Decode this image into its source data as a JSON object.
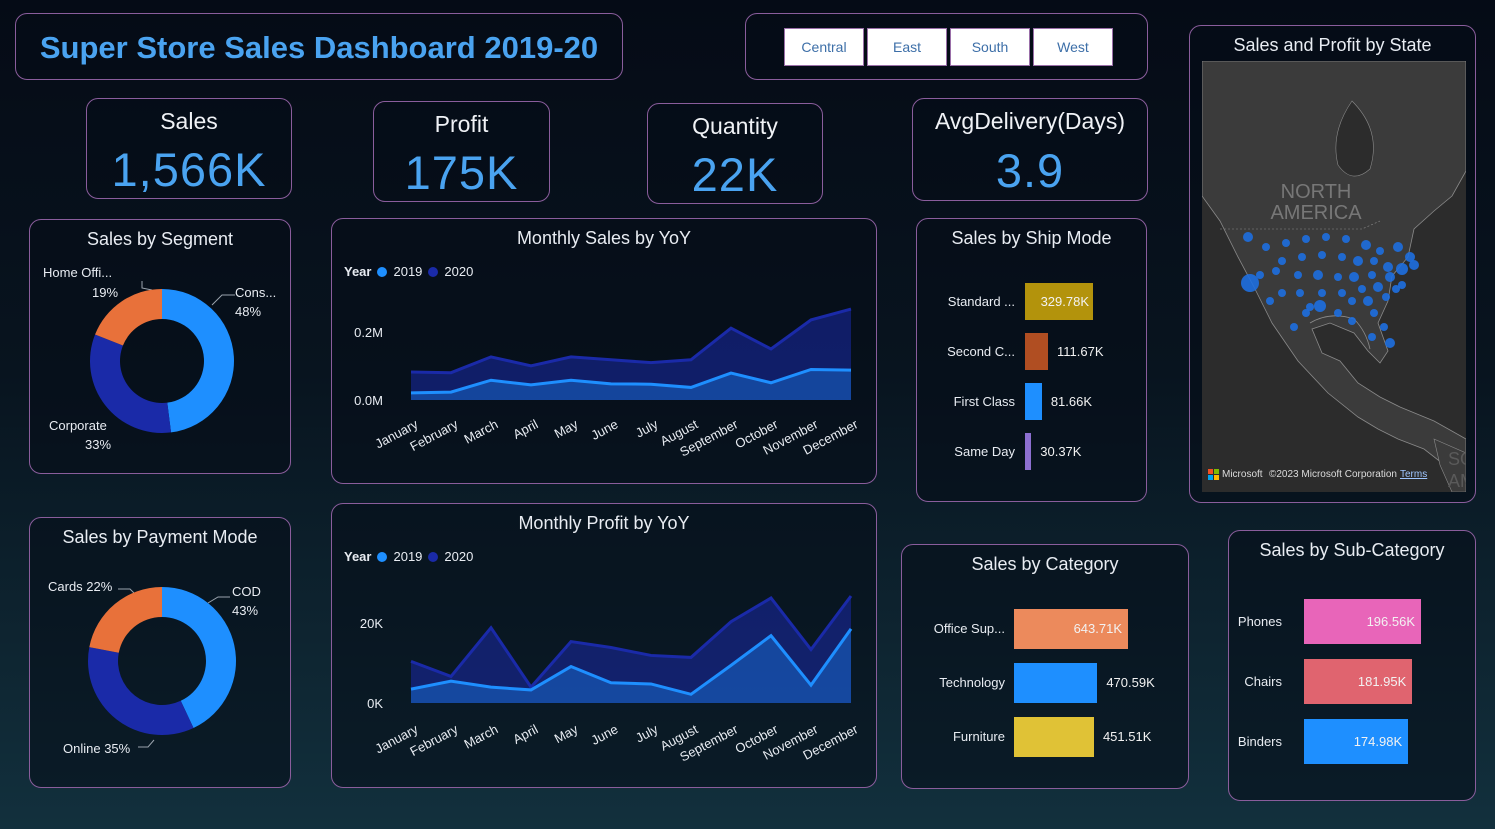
{
  "title": "Super Store Sales Dashboard 2019-20",
  "regions": [
    "Central",
    "East",
    "South",
    "West"
  ],
  "kpis": {
    "sales": {
      "label": "Sales",
      "value": "1,566K"
    },
    "profit": {
      "label": "Profit",
      "value": "175K"
    },
    "quantity": {
      "label": "Quantity",
      "value": "22K"
    },
    "avg_delivery": {
      "label": "AvgDelivery(Days)",
      "value": "3.9"
    }
  },
  "colors": {
    "y2019": "#1e8fff",
    "y2020": "#1a2aa8",
    "orange": "#e8713a",
    "accent": "#4aa3f0"
  },
  "segment": {
    "title": "Sales by Segment",
    "slices": [
      {
        "label": "Cons...",
        "pct": "48%",
        "value": 48,
        "color": "#1e8fff"
      },
      {
        "label": "Corporate",
        "pct": "33%",
        "value": 33,
        "color": "#1a2aa8"
      },
      {
        "label": "Home Offi...",
        "pct": "19%",
        "value": 19,
        "color": "#e8713a"
      }
    ]
  },
  "payment": {
    "title": "Sales by Payment Mode",
    "slices": [
      {
        "label": "COD",
        "pct": "43%",
        "value": 43,
        "color": "#1e8fff"
      },
      {
        "label": "Online 35%",
        "value": 35,
        "color": "#1a2aa8"
      },
      {
        "label": "Cards 22%",
        "value": 22,
        "color": "#e8713a"
      }
    ]
  },
  "legend": {
    "label": "Year",
    "series": [
      "2019",
      "2020"
    ]
  },
  "months": [
    "January",
    "February",
    "March",
    "April",
    "May",
    "June",
    "July",
    "August",
    "September",
    "October",
    "November",
    "December"
  ],
  "monthly_sales": {
    "title": "Monthly Sales by YoY",
    "yticks": [
      "0.2M",
      "0.0M"
    ],
    "chart_data": {
      "type": "area",
      "ylim": [
        0,
        0.27
      ],
      "series": [
        {
          "name": "2019",
          "values": [
            0.02,
            0.022,
            0.055,
            0.042,
            0.055,
            0.045,
            0.044,
            0.035,
            0.075,
            0.048,
            0.085,
            0.083
          ]
        },
        {
          "name": "2020",
          "values": [
            0.078,
            0.076,
            0.12,
            0.095,
            0.12,
            0.112,
            0.104,
            0.112,
            0.2,
            0.142,
            0.223,
            0.253
          ]
        }
      ]
    }
  },
  "monthly_profit": {
    "title": "Monthly Profit by YoY",
    "yticks": [
      "20K",
      "0K"
    ],
    "chart_data": {
      "type": "area",
      "ylim": [
        0,
        27000
      ],
      "series": [
        {
          "name": "2019",
          "values": [
            3500,
            5500,
            4000,
            3300,
            9200,
            5100,
            4800,
            2200,
            9500,
            17000,
            4500,
            18700
          ]
        },
        {
          "name": "2020",
          "values": [
            10500,
            6700,
            19000,
            4000,
            15500,
            14000,
            12000,
            11500,
            20500,
            26500,
            13500,
            27000
          ]
        }
      ]
    }
  },
  "ship_mode": {
    "title": "Sales by Ship Mode",
    "chart_data": {
      "type": "bar",
      "categories": [
        "Standard ...",
        "Second C...",
        "First Class",
        "Same Day"
      ],
      "values": [
        329.78,
        111.67,
        81.66,
        30.37
      ],
      "labels": [
        "329.78K",
        "111.67K",
        "81.66K",
        "30.37K"
      ],
      "colors": [
        "#b3930c",
        "#b04e22",
        "#1e8fff",
        "#8c6fd0"
      ]
    }
  },
  "category": {
    "title": "Sales by Category",
    "chart_data": {
      "type": "bar",
      "categories": [
        "Office Sup...",
        "Technology",
        "Furniture"
      ],
      "values": [
        643.71,
        470.59,
        451.51
      ],
      "labels": [
        "643.71K",
        "470.59K",
        "451.51K"
      ],
      "colors": [
        "#ec8a5c",
        "#1e8fff",
        "#e0c236"
      ]
    }
  },
  "subcategory": {
    "title": "Sales by Sub-Category",
    "chart_data": {
      "type": "bar",
      "categories": [
        "Phones",
        "Chairs",
        "Binders"
      ],
      "values": [
        196.56,
        181.95,
        174.98
      ],
      "labels": [
        "196.56K",
        "181.95K",
        "174.98K"
      ],
      "colors": [
        "#e865b9",
        "#e0646f",
        "#1e8fff"
      ]
    }
  },
  "map": {
    "title": "Sales and Profit by State",
    "region_label_1": "NORTH",
    "region_label_2": "AMERICA",
    "edge_label_1": "SO",
    "edge_label_2": "AM",
    "attribution_brand": "Microsoft Bing",
    "copyright": "©2023 Microsoft Corporation",
    "terms": "Terms"
  }
}
